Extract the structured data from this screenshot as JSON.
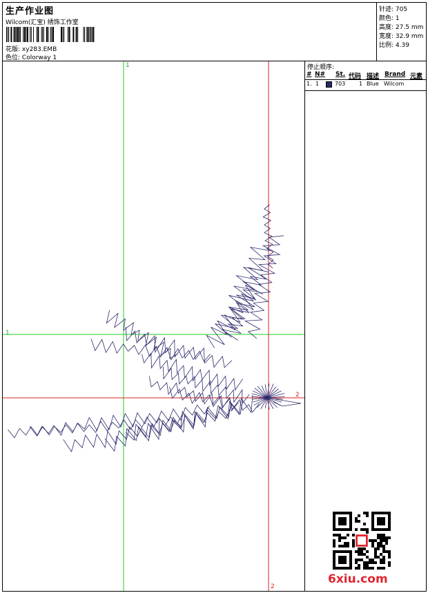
{
  "header": {
    "title": "生产作业图",
    "studio": "Wilcom(汇宝) 绣饰工作室",
    "file_label": "花版:",
    "file_value": "xy283.EMB",
    "color_label": "色位:",
    "color_value": "Colorway 1"
  },
  "stats": [
    {
      "label": "针迹:",
      "value": "705"
    },
    {
      "label": "颜色:",
      "value": "1"
    },
    {
      "label": "高度:",
      "value": "27.5 mm"
    },
    {
      "label": "宽度:",
      "value": "32.9 mm"
    },
    {
      "label": "比例:",
      "value": "4.39"
    }
  ],
  "stop_sequence": {
    "heading": "停止顺序:",
    "columns": [
      "#",
      "N#",
      "St.",
      "代码",
      "描述",
      "Brand",
      "元素"
    ],
    "rows": [
      {
        "index": "1.",
        "n": "1",
        "st": "703",
        "code": "1",
        "desc": "Blue",
        "brand": "Wilcom",
        "element": ""
      }
    ]
  },
  "guides": {
    "green_vertical": "1",
    "green_horizontal": "1",
    "red_horizontal": "2",
    "red_vertical": "2"
  },
  "thread_color": "#2b2a6b",
  "watermark": {
    "text": "6xiu.com"
  }
}
